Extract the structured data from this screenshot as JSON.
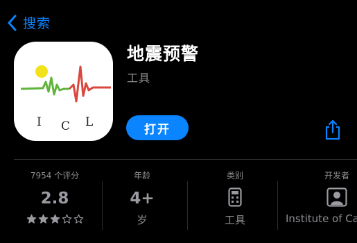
{
  "nav": {
    "back_label": "搜索"
  },
  "app": {
    "name": "地震预警",
    "category_subtitle": "工具",
    "open_label": "打开",
    "icon_letters": [
      "I",
      "C",
      "L"
    ]
  },
  "colors": {
    "accent": "#0a84ff",
    "background": "#000000",
    "icon_green": "#5fb43a",
    "icon_red": "#d9473f",
    "icon_sun": "#f2e21c"
  },
  "info": {
    "ratings": {
      "label": "7954 个评分",
      "value": "2.8",
      "stars_filled": 3,
      "stars_total": 5
    },
    "age": {
      "label": "年龄",
      "value": "4+",
      "sub": "岁"
    },
    "category": {
      "label": "类别",
      "icon": "calculator-icon",
      "sub": "工具"
    },
    "developer": {
      "label": "开发者",
      "icon": "person-icon",
      "sub": "Institute of Ca"
    }
  }
}
